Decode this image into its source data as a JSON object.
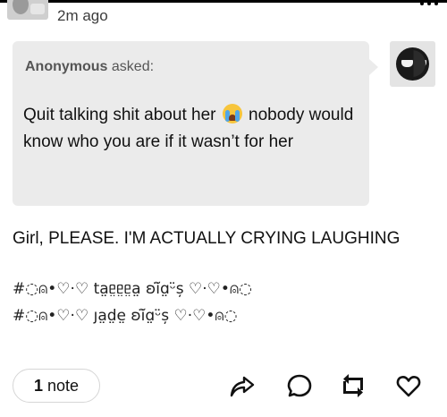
{
  "post": {
    "timestamp": "2m ago",
    "ask": {
      "asker_name": "Anonymous",
      "asker_suffix": "asked:",
      "question_before_emoji": "Quit talking shit about her",
      "emoji": "loudly-crying-face",
      "question_after_emoji": "nobody would know who you are if it wasn’t for her"
    },
    "answer": "Girl, PLEASE. I'M ACTUALLY CRYING LAUGHING",
    "tags": [
      "#◌⍝•♡·♡ ta̤ᥱ̤ᥱ̤ᥱ̤a̤ ʚĭ̈ɑ̤ᵕ̈ș ♡·♡•⍝◌",
      "#◌⍝•♡·♡ ȷa̤d̤e̤ ʚĭ̈ɑ̤ᵕ̈ș ♡·♡•⍝◌"
    ]
  },
  "footer": {
    "note_count": "1",
    "note_label": "note",
    "actions": [
      "share-icon",
      "reply-icon",
      "reblog-icon",
      "like-icon"
    ]
  },
  "colors": {
    "ask_bubble": "#ebebeb",
    "meta_text": "#555555"
  }
}
